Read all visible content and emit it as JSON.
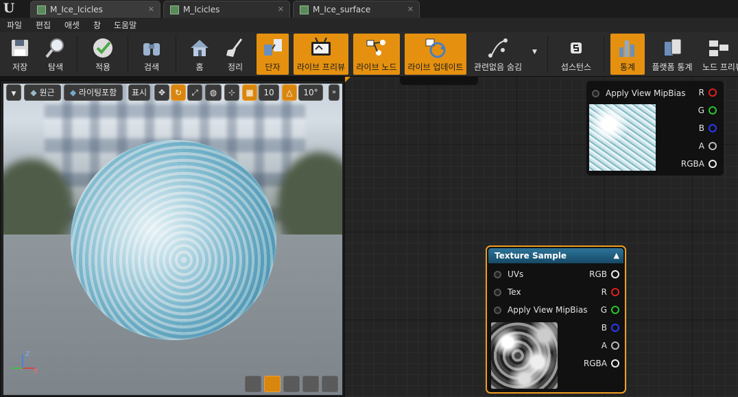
{
  "tabs": [
    {
      "label": "M_Ice_Icicles"
    },
    {
      "label": "M_Icicles"
    },
    {
      "label": "M_Ice_surface"
    }
  ],
  "menu": [
    "파일",
    "편집",
    "애셋",
    "창",
    "도움말"
  ],
  "toolbar": {
    "save": "저장",
    "browse": "탐색",
    "apply": "적용",
    "search": "검색",
    "home": "홈",
    "clean": "정리",
    "hide_connectors": "단자",
    "live_preview": "라이브 프리뷰",
    "live_nodes": "라이브 노드",
    "live_update": "라이브 업데이트",
    "hide_unrelated": "관련없음 숨김",
    "substance": "섭스턴스",
    "stats": "통계",
    "platform_stats": "플랫폼 통계",
    "node_preview": "노드 프리뷰"
  },
  "viewport": {
    "perspective": "원근",
    "lit": "라이팅포함",
    "show": "표시",
    "grid_size": "10",
    "rot_snap": "10°",
    "axes": {
      "z": "Z",
      "x": "X",
      "y": "Y"
    }
  },
  "node_top": {
    "apply_mip": "Apply View MipBias",
    "outputs": [
      "R",
      "G",
      "B",
      "A",
      "RGBA"
    ]
  },
  "node_texture": {
    "title": "Texture Sample",
    "inputs": [
      "UVs",
      "Tex",
      "Apply View MipBias"
    ],
    "outputs": [
      "RGB",
      "R",
      "G",
      "B",
      "A",
      "RGBA"
    ]
  },
  "colors": {
    "accent": "#e5910f",
    "r": "#e0201c",
    "g": "#28c828",
    "b": "#2020e0",
    "node_header": "#1f5a7a"
  }
}
